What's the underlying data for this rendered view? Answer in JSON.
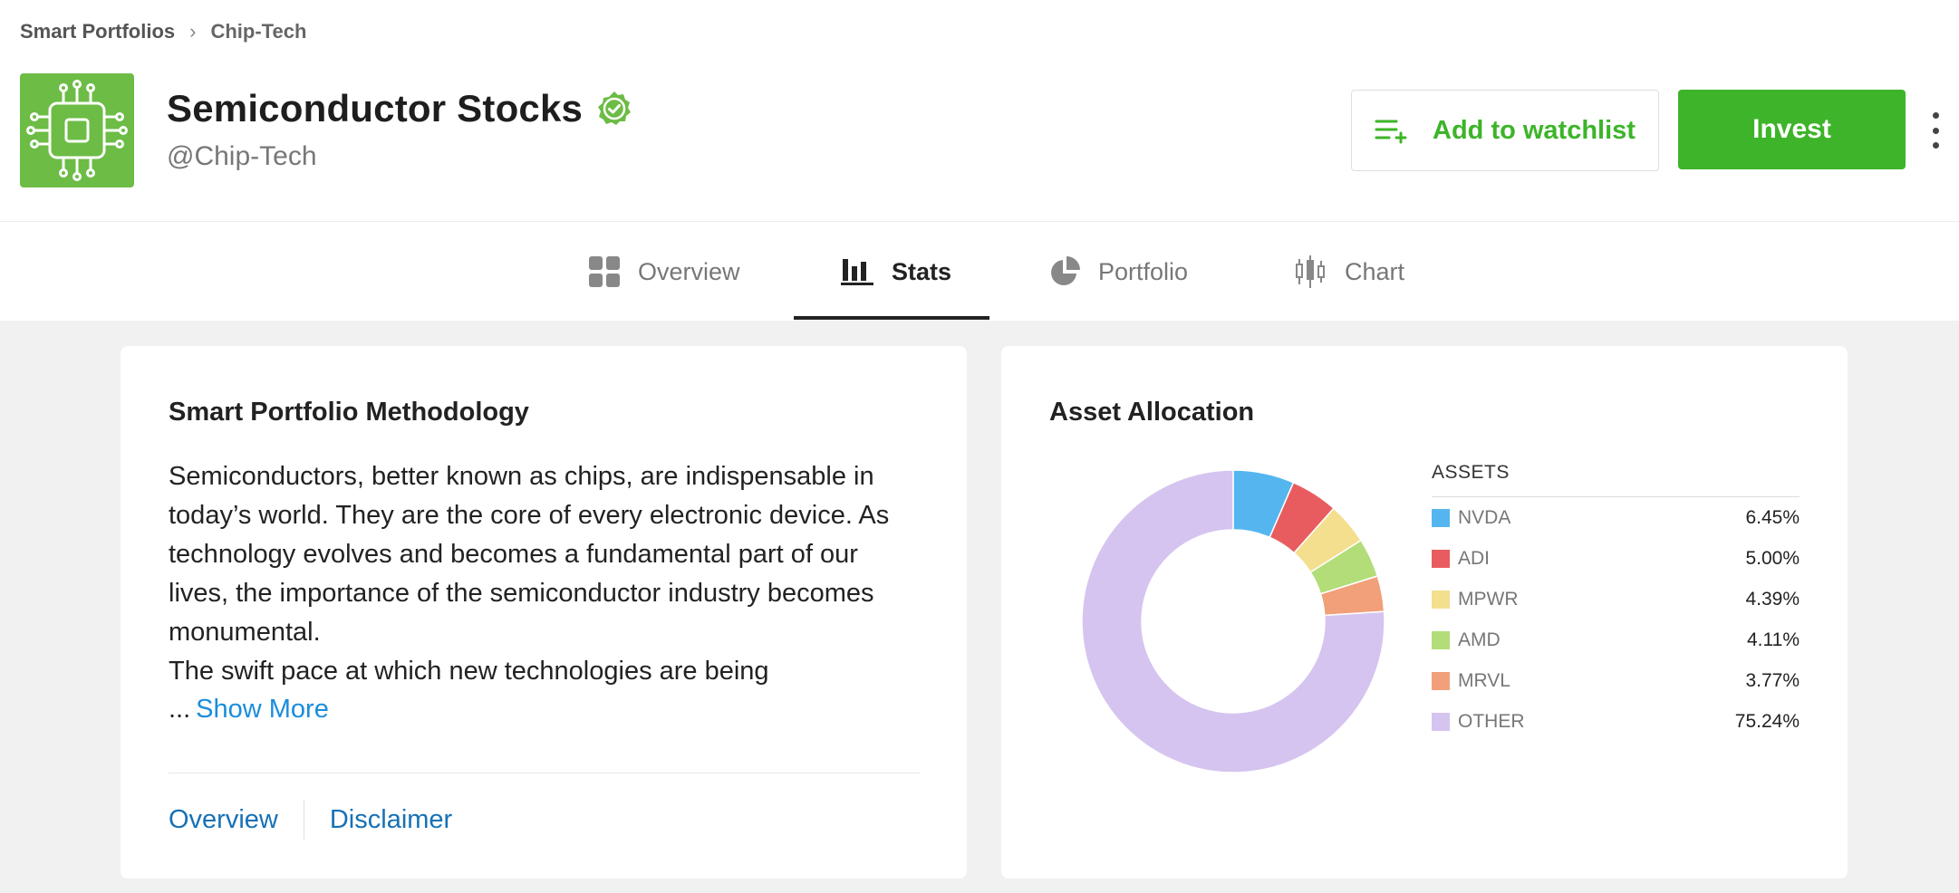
{
  "breadcrumb": {
    "root": "Smart Portfolios",
    "separator": "›",
    "current": "Chip-Tech"
  },
  "header": {
    "title": "Semiconductor Stocks",
    "handle": "@Chip-Tech",
    "watchlist_label": "Add to watchlist",
    "invest_label": "Invest",
    "accent_color": "#3db429"
  },
  "tabs": [
    {
      "label": "Overview",
      "icon": "grid-icon",
      "active": false
    },
    {
      "label": "Stats",
      "icon": "bar-chart-icon",
      "active": true
    },
    {
      "label": "Portfolio",
      "icon": "pie-chart-icon",
      "active": false
    },
    {
      "label": "Chart",
      "icon": "candlestick-icon",
      "active": false
    }
  ],
  "methodology": {
    "title": "Smart Portfolio Methodology",
    "paragraph1": "Semiconductors, better known as chips, are indispensable in today’s world. They are the core of every electronic device. As technology evolves and becomes a fundamental part of our lives, the importance of the semiconductor industry becomes monumental.",
    "paragraph2": "The swift pace at which new technologies are being",
    "ellipsis": "...",
    "show_more": "Show More",
    "links": [
      "Overview",
      "Disclaimer"
    ]
  },
  "allocation": {
    "title": "Asset Allocation",
    "legend_header": "ASSETS"
  },
  "chart_data": {
    "type": "pie",
    "donut": true,
    "title": "Asset Allocation",
    "legend_title": "ASSETS",
    "categories": [
      "NVDA",
      "ADI",
      "MPWR",
      "AMD",
      "MRVL",
      "OTHER"
    ],
    "values": [
      6.45,
      5.0,
      4.39,
      4.11,
      3.77,
      75.24
    ],
    "labels": [
      "6.45%",
      "5.00%",
      "4.39%",
      "4.11%",
      "3.77%",
      "75.24%"
    ],
    "colors": [
      "#55b6ef",
      "#e85c5f",
      "#f3df8e",
      "#b2dd78",
      "#f2a07a",
      "#d5c4ef"
    ],
    "legend_position": "right"
  }
}
